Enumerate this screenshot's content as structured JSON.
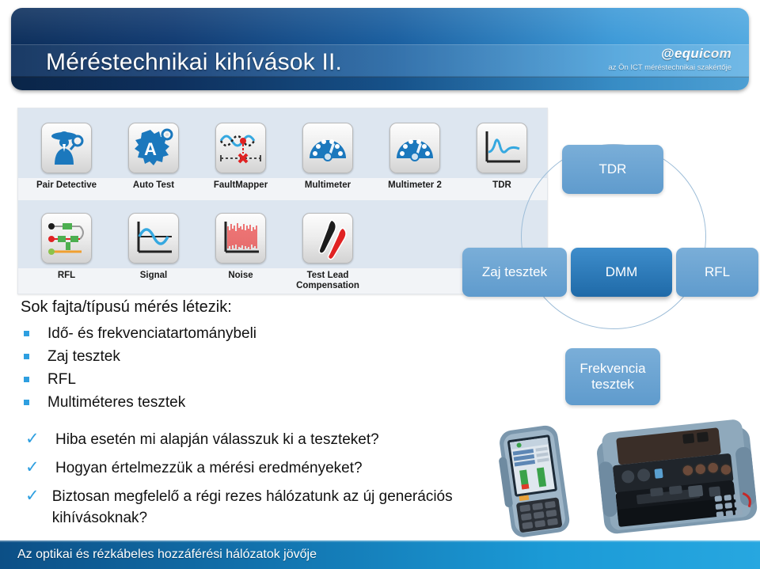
{
  "header": {
    "title": "Méréstechnikai kihívások II.",
    "logo": {
      "at_symbol": "@",
      "brand_equ": "equi",
      "brand_com": "com",
      "tagline": "az Ön ICT méréstechnikai szakértője"
    },
    "colors": {
      "navy": "#0d2f5c",
      "mid_blue": "#1a5fa0",
      "light_blue": "#52a9e0"
    }
  },
  "toolbar": {
    "row1": [
      {
        "label": "Pair Detective",
        "icon": "detective-icon"
      },
      {
        "label": "Auto Test",
        "icon": "auto-test-icon"
      },
      {
        "label": "FaultMapper",
        "icon": "fault-mapper-icon"
      },
      {
        "label": "Multimeter",
        "icon": "gauge-icon"
      },
      {
        "label": "Multimeter 2",
        "icon": "gauge-icon"
      },
      {
        "label": "TDR",
        "icon": "tdr-trace-icon"
      }
    ],
    "row2": [
      {
        "label": "RFL",
        "icon": "rfl-wiring-icon"
      },
      {
        "label": "Signal",
        "icon": "sine-wave-icon"
      },
      {
        "label": "Noise",
        "icon": "noise-waveform-icon"
      },
      {
        "label": "Test Lead Compensation",
        "icon": "test-probes-icon"
      }
    ]
  },
  "diagram": {
    "nodes": {
      "top": "TDR",
      "left": "Zaj tesztek",
      "center": "DMM",
      "right": "RFL",
      "bottom": "Frekvencia tesztek",
      "bottom_line1": "Frekvencia",
      "bottom_line2": "tesztek"
    },
    "colors": {
      "node": "#5f9bcd",
      "node_center": "#1f6aa8",
      "ring": "#9dbdd8"
    }
  },
  "content": {
    "lead": "Sok fajta/típusú mérés létezik:",
    "bullets": [
      "Idő- és frekvenciatartománybeli",
      "Zaj tesztek",
      "RFL",
      "Multiméteres tesztek"
    ],
    "questions": [
      "Hiba esetén mi alapján válasszuk ki a teszteket?",
      "Hogyan értelmezzük a mérési eredményeket?",
      "Biztosan megfelelő a régi rezes hálózatunk az új generációs kihívásoknak?"
    ],
    "check_glyph": "✓",
    "bullet_color": "#2e9fe0"
  },
  "devices": {
    "handheld": "handheld-tester-photo",
    "benchtop": "benchtop-tester-photo"
  },
  "footer": {
    "text": "Az optikai és rézkábeles hozzáférési hálózatok jövője"
  }
}
